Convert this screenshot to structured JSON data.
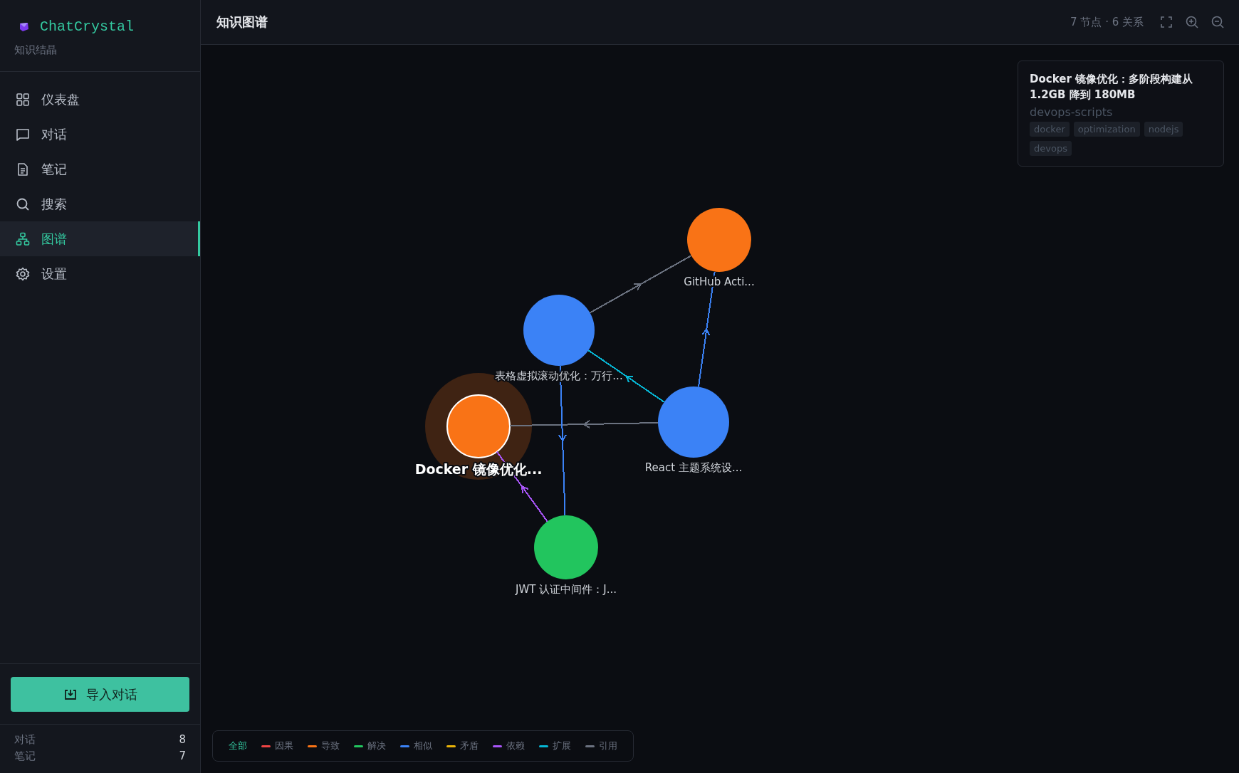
{
  "sidebar": {
    "logo": "ChatCrystal",
    "subtitle": "知识结晶",
    "items": [
      {
        "label": "仪表盘",
        "kind": "grid",
        "selected": false
      },
      {
        "label": "对话",
        "kind": "chat",
        "selected": false
      },
      {
        "label": "笔记",
        "kind": "note",
        "selected": false
      },
      {
        "label": "搜索",
        "kind": "search",
        "selected": false
      },
      {
        "label": "图谱",
        "kind": "graph",
        "selected": true
      },
      {
        "label": "设置",
        "kind": "gear",
        "selected": false
      }
    ],
    "import_button": "导入对话",
    "stats": [
      {
        "label": "对话",
        "value": "8"
      },
      {
        "label": "笔记",
        "value": "7"
      }
    ]
  },
  "header": {
    "title": "知识图谱",
    "counts": "7 节点 · 6 关系"
  },
  "graph": {
    "nodes": [
      {
        "label": "GitHub Acti...",
        "color": "#f97316",
        "selected": false
      },
      {
        "label": "表格虚拟滚动优化：万行...",
        "color": "#3b82f6",
        "selected": false
      },
      {
        "label": "Docker 镜像优化...",
        "color": "#f97316",
        "selected": true
      },
      {
        "label": "React 主题系统设...",
        "color": "#3b82f6",
        "selected": false
      },
      {
        "label": "JWT 认证中间件：J...",
        "color": "#22c55e",
        "selected": false
      }
    ],
    "edges": [
      {
        "color": "#6b7280"
      },
      {
        "color": "#3b82f6"
      },
      {
        "color": "#06b6d4"
      },
      {
        "color": "#6b7280"
      },
      {
        "color": "#3b82f6"
      },
      {
        "color": "#a855f7"
      }
    ]
  },
  "detail": {
    "title": "Docker 镜像优化：多阶段构建从 1.2GB 降到 180MB",
    "project": "devops-scripts",
    "tags": [
      "docker",
      "optimization",
      "nodejs",
      "devops"
    ]
  },
  "legend": [
    {
      "label": "全部",
      "selected": true
    },
    {
      "label": "因果",
      "color": "#ef4444",
      "selected": false
    },
    {
      "label": "导致",
      "color": "#f97316",
      "selected": false
    },
    {
      "label": "解决",
      "color": "#22c55e",
      "selected": false
    },
    {
      "label": "相似",
      "color": "#3b82f6",
      "selected": false
    },
    {
      "label": "矛盾",
      "color": "#eab308",
      "selected": false
    },
    {
      "label": "依赖",
      "color": "#a855f7",
      "selected": false
    },
    {
      "label": "扩展",
      "color": "#06b6d4",
      "selected": false
    },
    {
      "label": "引用",
      "color": "#6b7280",
      "selected": false
    }
  ]
}
